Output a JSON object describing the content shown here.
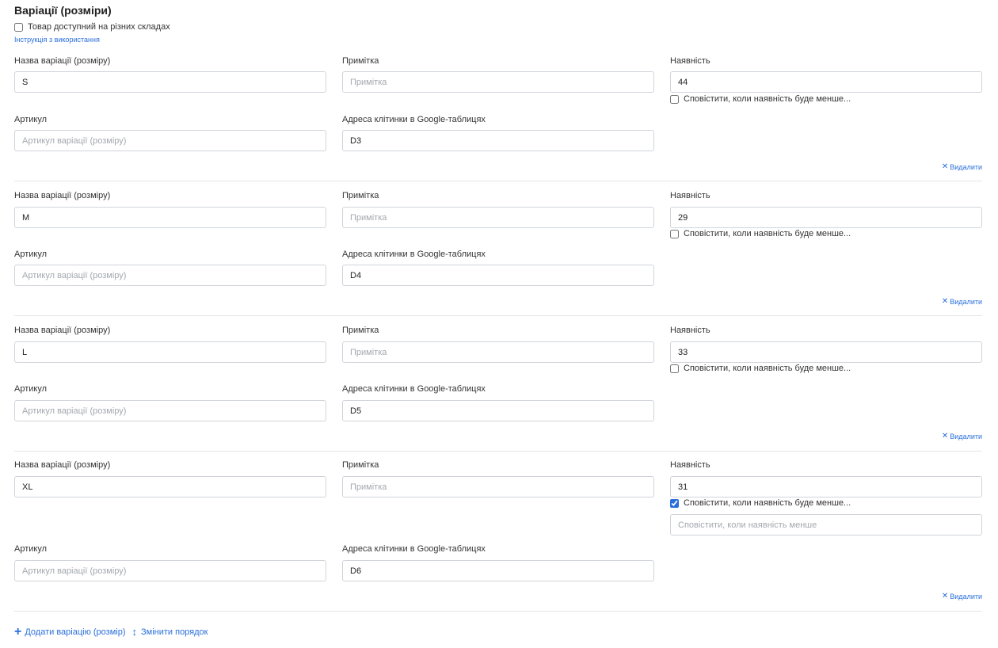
{
  "section": {
    "title": "Варіації (розміри)",
    "multi_warehouse_label": "Товар доступний на різних складах",
    "instruction_link": "Інструкція з використання"
  },
  "labels": {
    "name": "Назва варіації (розміру)",
    "note": "Примітка",
    "stock": "Наявність",
    "sku": "Артикул",
    "cell": "Адреса клітинки в Google-таблицях",
    "notify": "Сповістити, коли наявність буде менше...",
    "delete": "Видалити"
  },
  "placeholders": {
    "note": "Примітка",
    "sku": "Артикул варіації (розміру)",
    "notify_threshold": "Сповістити, коли наявність менше"
  },
  "variations": [
    {
      "name": "S",
      "note": "",
      "stock": "44",
      "sku": "",
      "cell": "D3",
      "notify_checked": false
    },
    {
      "name": "M",
      "note": "",
      "stock": "29",
      "sku": "",
      "cell": "D4",
      "notify_checked": false
    },
    {
      "name": "L",
      "note": "",
      "stock": "33",
      "sku": "",
      "cell": "D5",
      "notify_checked": false
    },
    {
      "name": "XL",
      "note": "",
      "stock": "31",
      "sku": "",
      "cell": "D6",
      "notify_checked": true
    }
  ],
  "actions": {
    "add_variation": "Додати варіацію (розмір)",
    "reorder": "Змінити порядок"
  },
  "colors": {
    "accent": "#2a6fdb",
    "border": "#d0d4da",
    "separator": "#e3e5e8"
  }
}
